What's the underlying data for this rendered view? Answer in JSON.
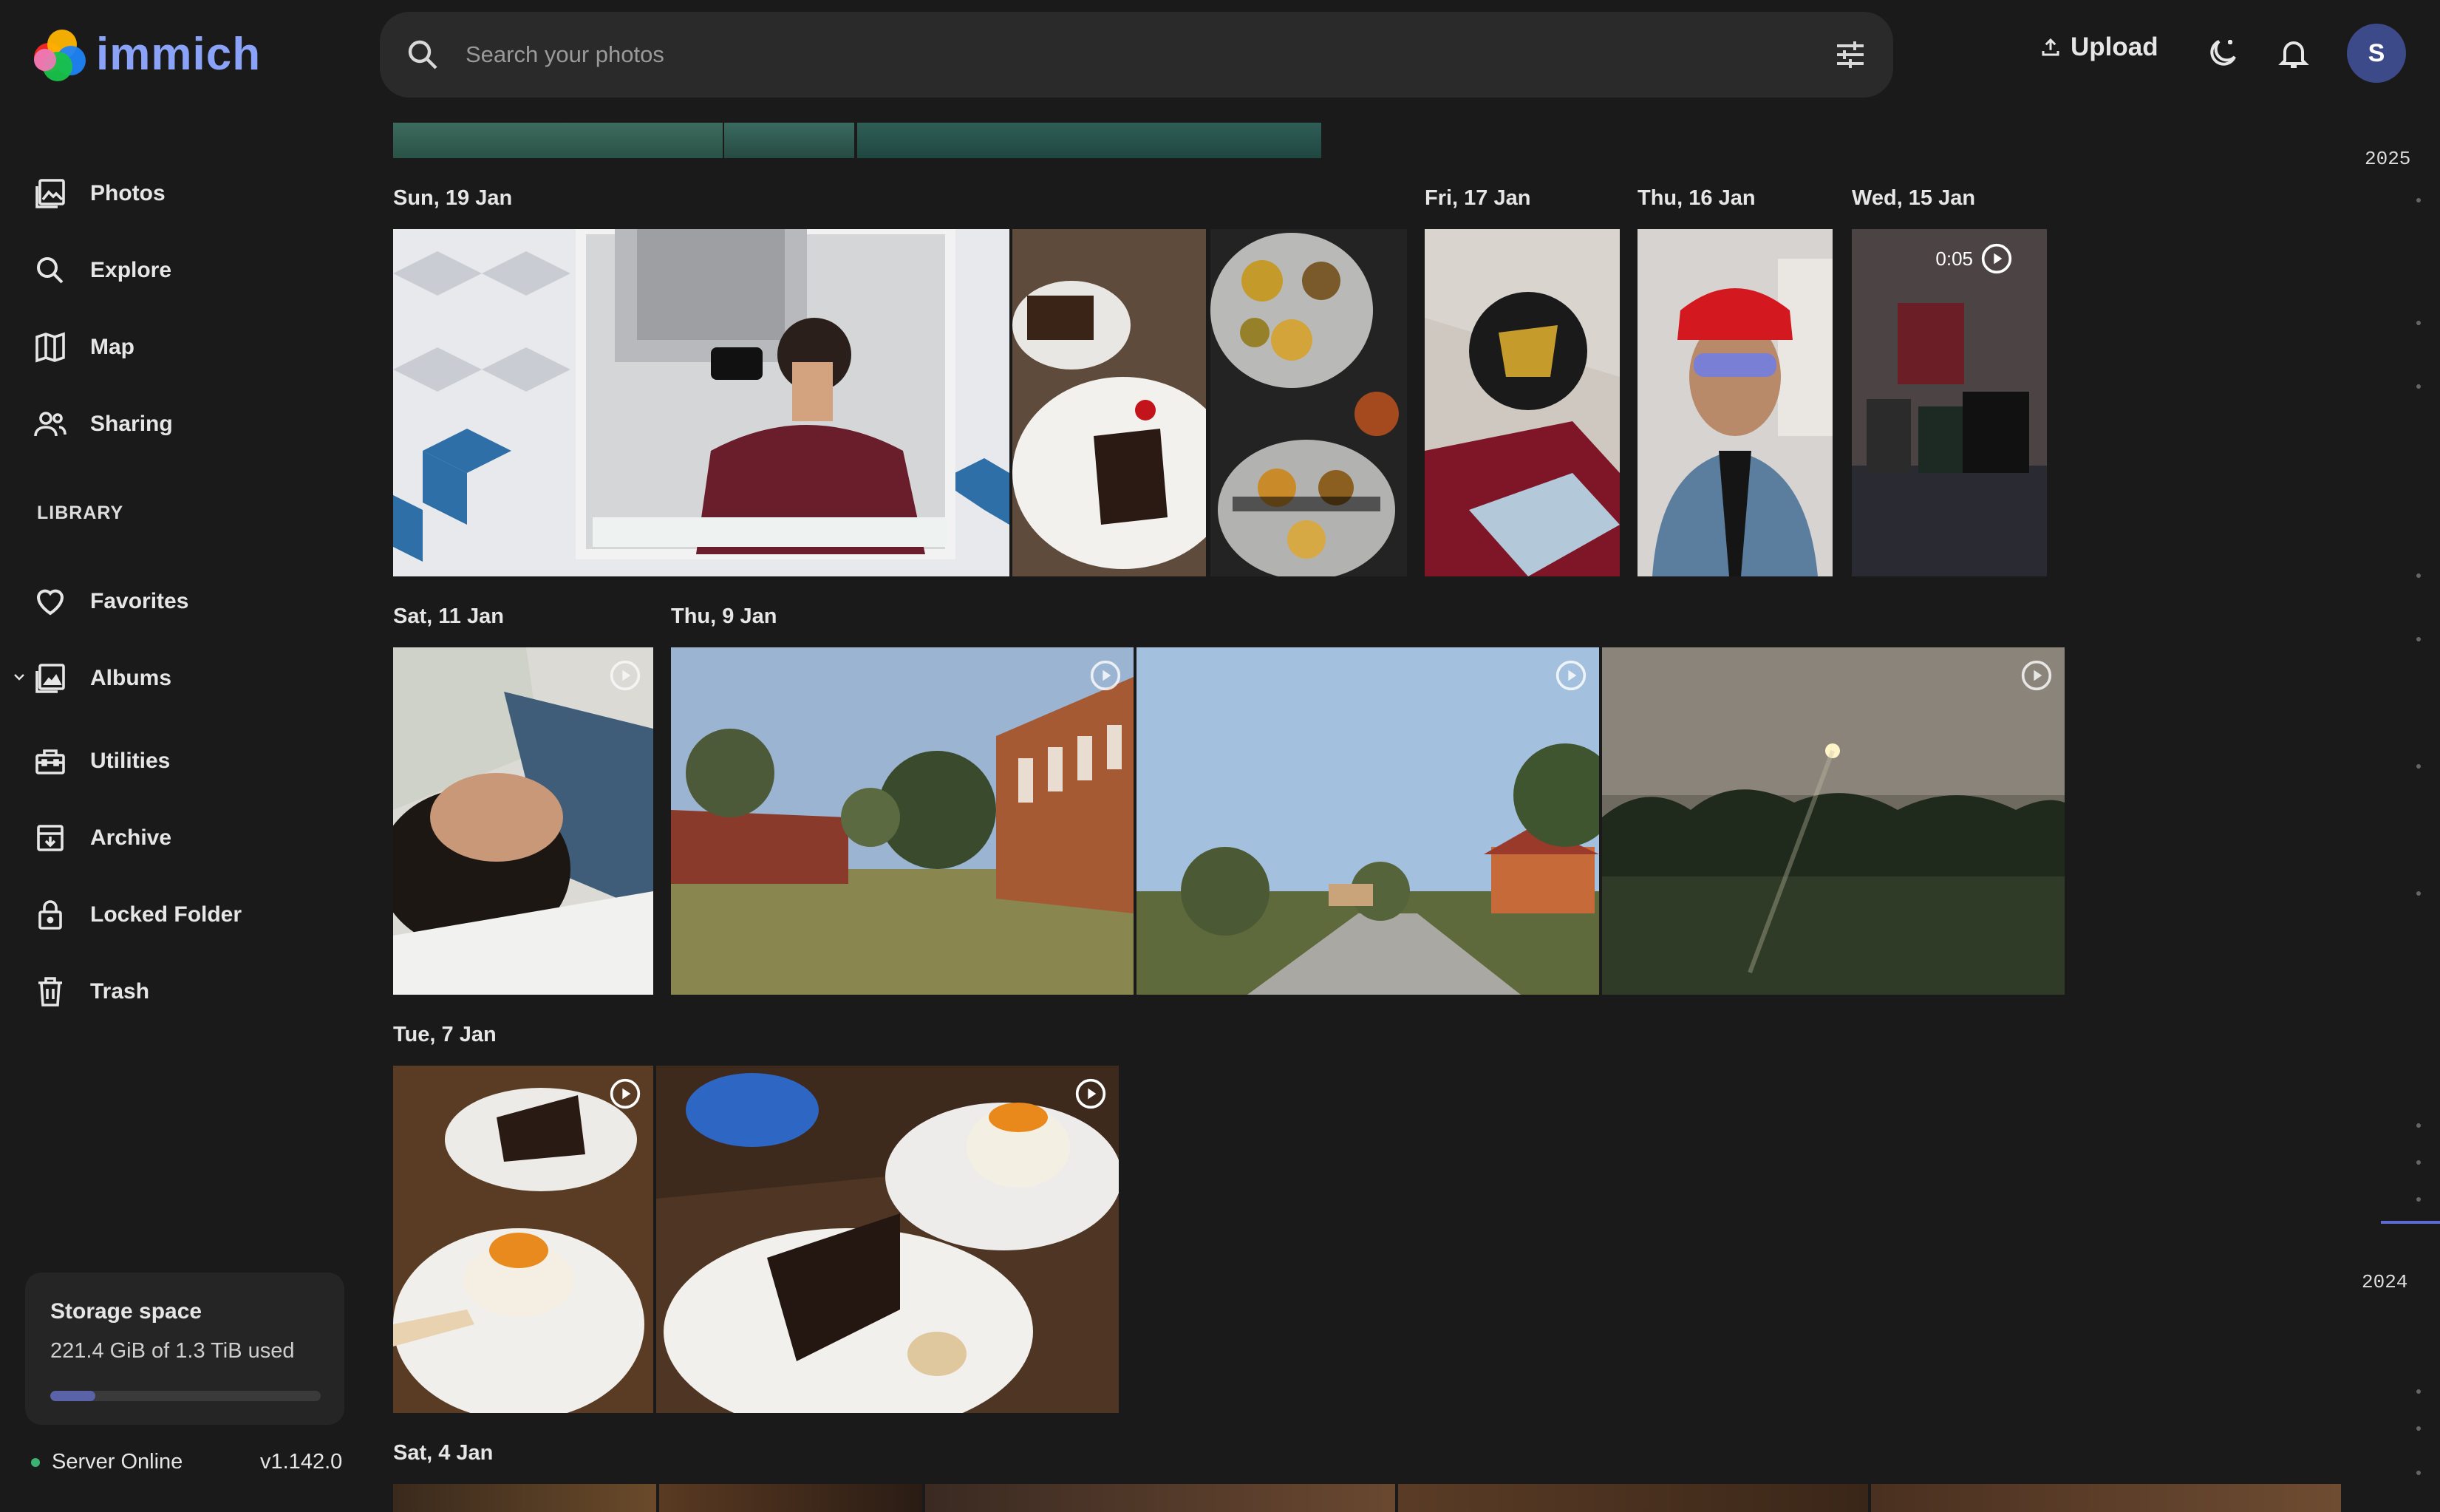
{
  "app": {
    "name": "immich"
  },
  "search": {
    "placeholder": "Search your photos"
  },
  "topbar": {
    "upload_label": "Upload",
    "avatar_initial": "S"
  },
  "sidebar": {
    "items": [
      {
        "label": "Photos",
        "icon": "photos-icon"
      },
      {
        "label": "Explore",
        "icon": "search-icon"
      },
      {
        "label": "Map",
        "icon": "map-icon"
      },
      {
        "label": "Sharing",
        "icon": "people-icon"
      }
    ],
    "library_label": "LIBRARY",
    "library_items": [
      {
        "label": "Favorites",
        "icon": "heart-icon"
      },
      {
        "label": "Albums",
        "icon": "album-icon"
      },
      {
        "label": "Utilities",
        "icon": "toolbox-icon"
      },
      {
        "label": "Archive",
        "icon": "archive-icon"
      },
      {
        "label": "Locked Folder",
        "icon": "lock-icon"
      },
      {
        "label": "Trash",
        "icon": "trash-icon"
      }
    ]
  },
  "storage": {
    "title": "Storage space",
    "usage": "221.4 GiB of 1.3 TiB used",
    "used_fraction": 0.166
  },
  "server": {
    "status": "Server Online",
    "version": "v1.142.0"
  },
  "timeline": {
    "dates": [
      "Sun, 19 Jan",
      "Fri, 17 Jan",
      "Thu, 16 Jan",
      "Wed, 15 Jan",
      "Sat, 11 Jan",
      "Thu, 9 Jan",
      "Tue, 7 Jan",
      "Sat, 4 Jan"
    ],
    "video_duration": "0:05"
  },
  "scrubber": {
    "years": [
      "2025",
      "2024"
    ]
  },
  "colors": {
    "accent": "#8aa2f7",
    "background": "#1a1a1a",
    "online": "#3bb273"
  }
}
